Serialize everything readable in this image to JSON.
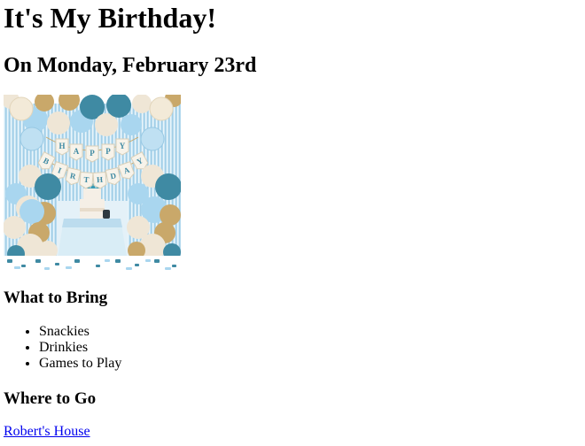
{
  "page": {
    "title": "It's My Birthday!",
    "date_line": "On Monday, February 23rd"
  },
  "hero_image": {
    "banner_letters": [
      "H",
      "A",
      "P",
      "P",
      "Y",
      "B",
      "I",
      "R",
      "T",
      "H",
      "D",
      "A",
      "Y"
    ]
  },
  "bring": {
    "heading": "What to Bring",
    "items": [
      "Snackies",
      "Drinkies",
      "Games to Play"
    ]
  },
  "where": {
    "heading": "Where to Go",
    "link_text": "Robert's House"
  },
  "colors": {
    "link": "#0000ee",
    "text": "#000000",
    "balloon_teal": "#3f8aa3",
    "balloon_light_blue": "#a9d6ef",
    "balloon_cream": "#efe6d6",
    "balloon_gold": "#c9a86a",
    "curtain": "#bfe0f2"
  }
}
